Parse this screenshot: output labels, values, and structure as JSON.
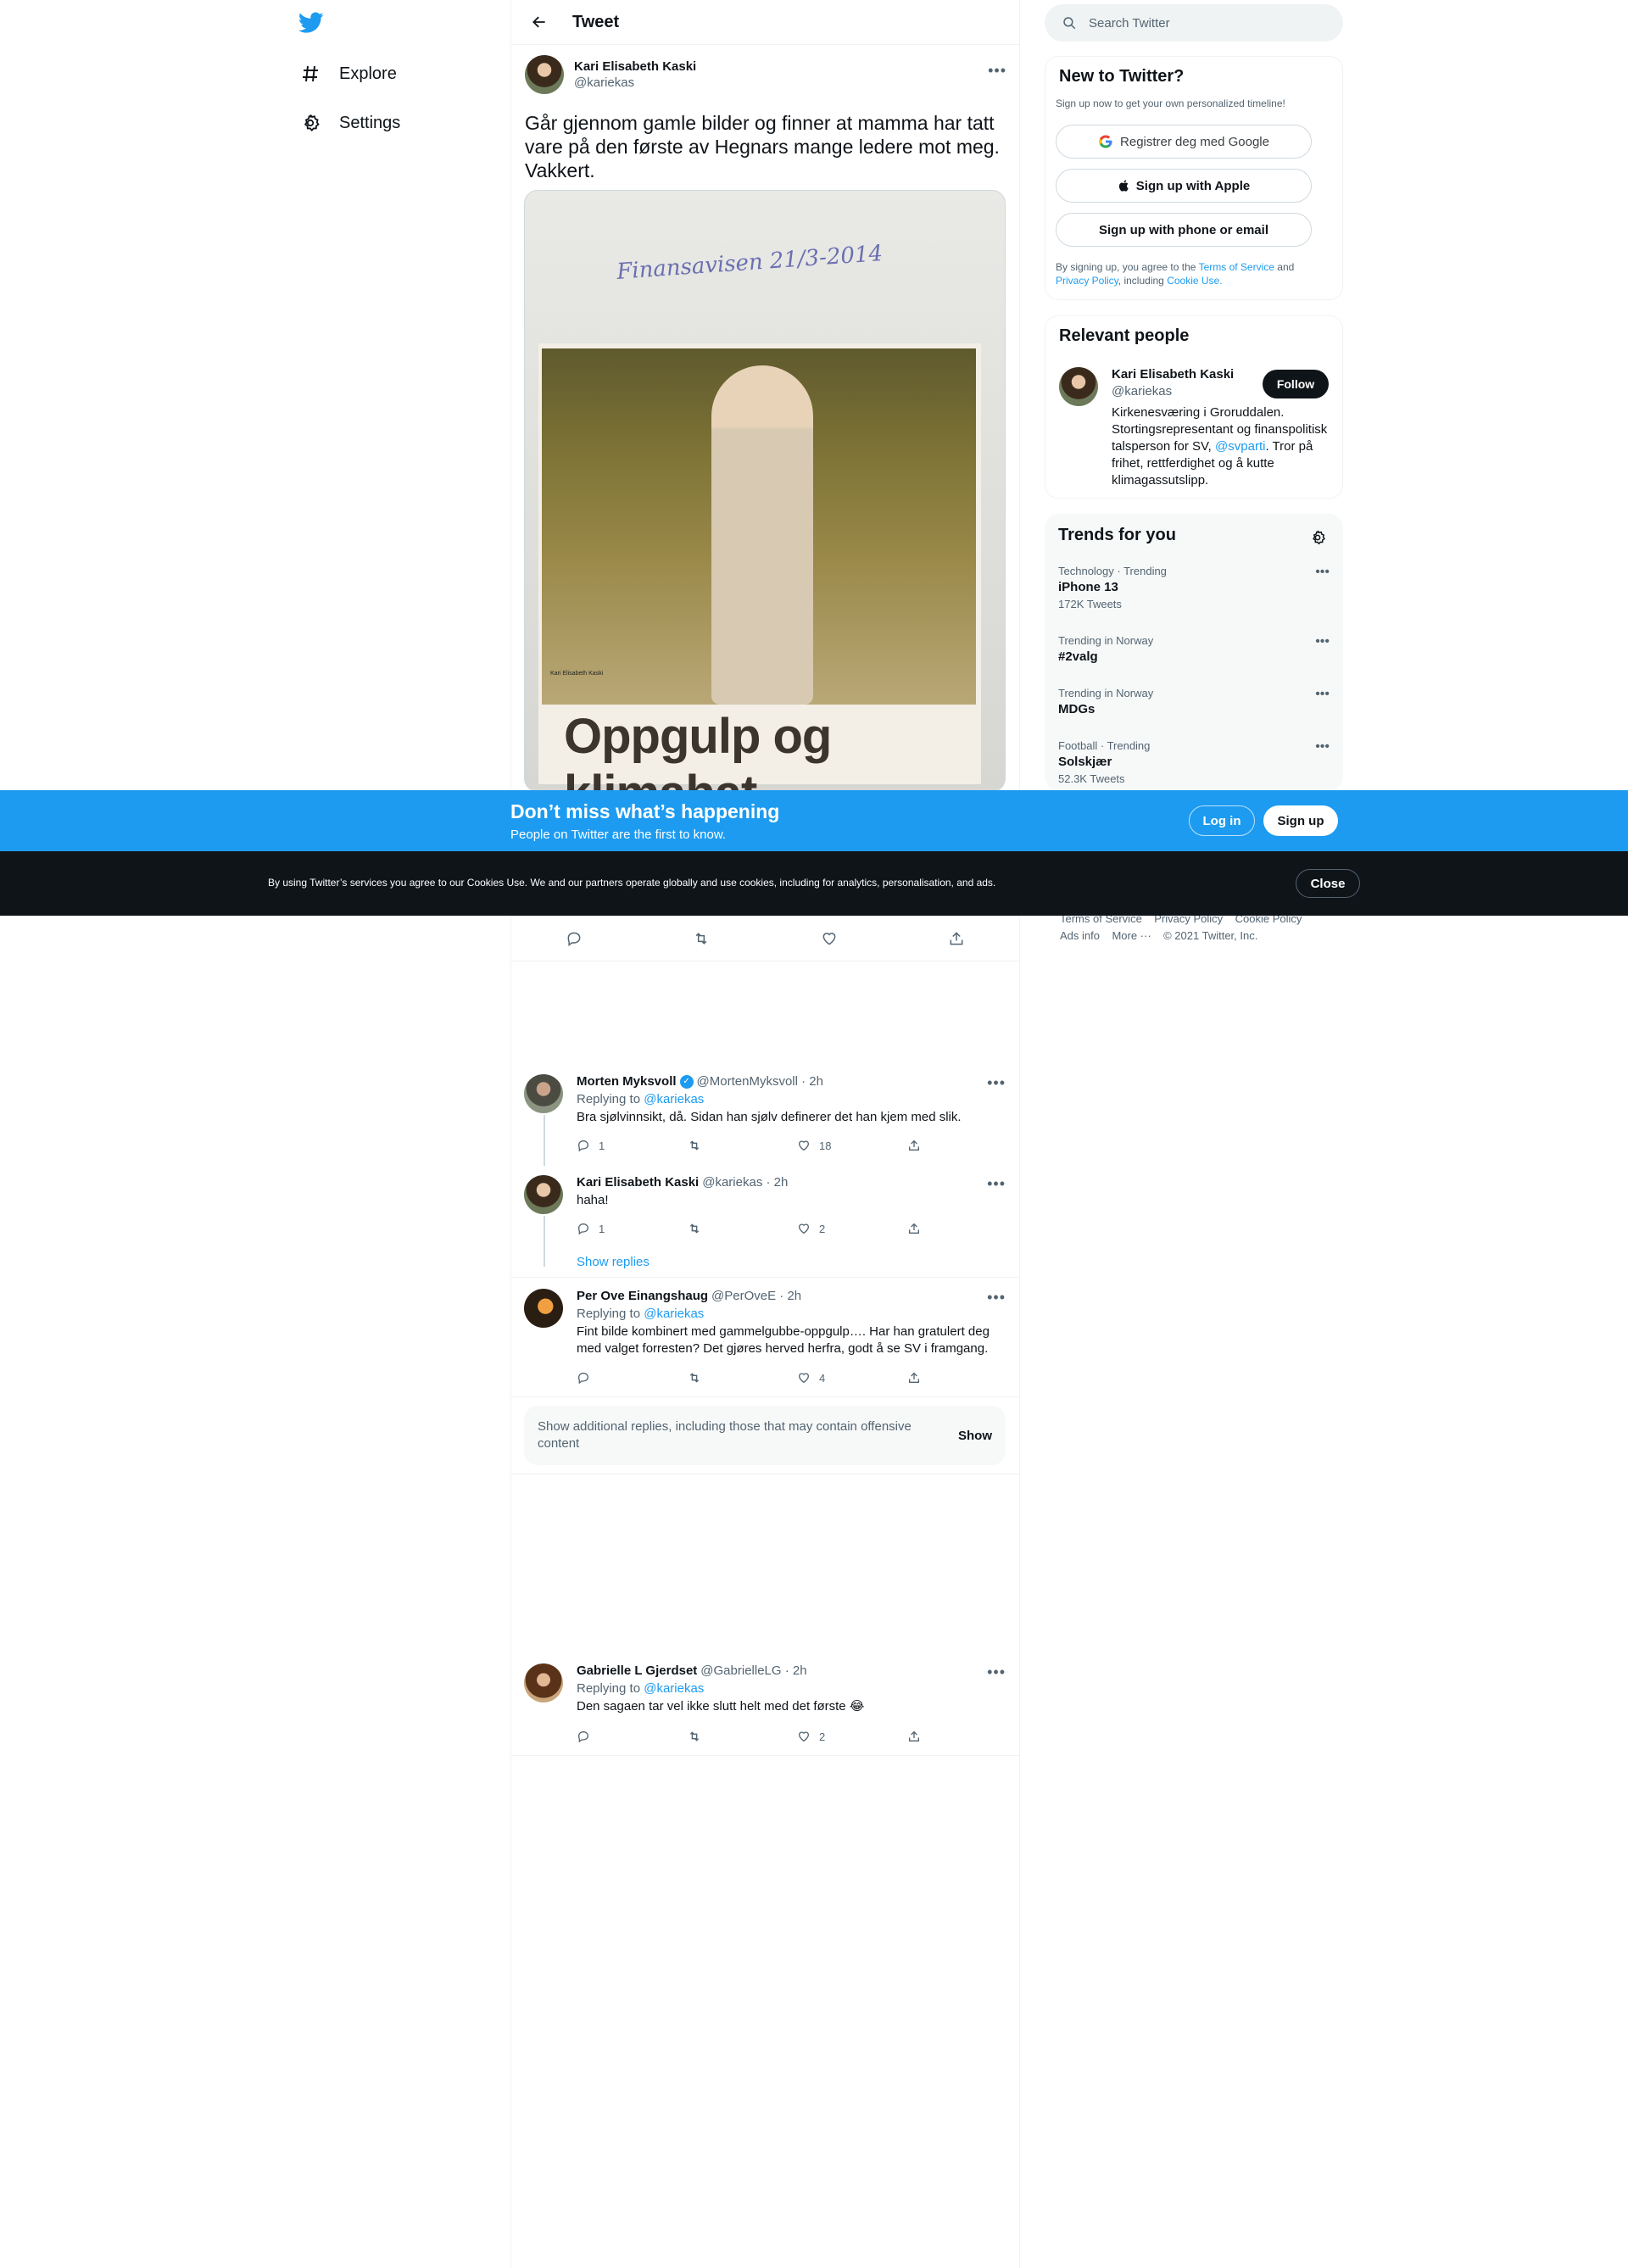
{
  "nav": {
    "items": [
      {
        "label": "Explore",
        "icon": "hashtag-icon"
      },
      {
        "label": "Settings",
        "icon": "gear-icon"
      }
    ]
  },
  "header": {
    "title": "Tweet"
  },
  "tweet": {
    "name": "Kari Elisabeth Kaski",
    "handle": "@kariekas",
    "text": "Går gjennom gamle bilder og finner at mamma har tatt vare på den første av Hegnars mange ledere mot meg. Vakkert.",
    "photo": {
      "handwriting": "Finansavisen 21/3-2014",
      "small_caption": "Kari Elisabeth Kaski",
      "headline": "Oppgulp og klimahat"
    }
  },
  "replies": [
    {
      "name": "Morten Myksvoll",
      "verified": true,
      "handle_time": "@MortenMyksvoll · 2h",
      "replying_prefix": "Replying to",
      "replying_to": "@kariekas",
      "text": "Bra sjølvinnsikt, då. Sidan han sjølv definerer det han kjem med slik.",
      "replies": "1",
      "retweets": "",
      "likes": "18"
    },
    {
      "name": "Kari Elisabeth Kaski",
      "handle_time": "@kariekas · 2h",
      "text": "haha!",
      "replies": "1",
      "retweets": "",
      "likes": "2",
      "show_replies": "Show replies"
    },
    {
      "name": "Per Ove Einangshaug",
      "handle_time": "@PerOveE · 2h",
      "replying_prefix": "Replying to",
      "replying_to": "@kariekas",
      "text": "Fint bilde kombinert med gammelgubbe-oppgulp…. Har han gratulert deg med valget forresten? Det gjøres herved herfra, godt å se SV i framgang.",
      "replies": "",
      "retweets": "",
      "likes": "4"
    },
    {
      "name": "Gabrielle L Gjerdset",
      "handle_time": "@GabrielleLG · 2h",
      "replying_prefix": "Replying to",
      "replying_to": "@kariekas",
      "text": "Den sagaen tar vel ikke slutt helt med det første 😂",
      "replies": "",
      "retweets": "",
      "likes": "2"
    }
  ],
  "show_more": {
    "text": "Show additional replies, including those that may contain offensive content",
    "button": "Show"
  },
  "search": {
    "placeholder": "Search Twitter"
  },
  "new_to_twitter": {
    "title": "New to Twitter?",
    "subtitle": "Sign up now to get your own personalized timeline!",
    "google": "Registrer deg med Google",
    "apple": "Sign up with Apple",
    "phone": "Sign up with phone or email",
    "terms_prefix": "By signing up, you agree to the",
    "terms": "Terms of Service",
    "and": "and",
    "privacy": "Privacy Policy",
    "including": ", including",
    "cookie": "Cookie Use."
  },
  "relevant": {
    "title": "Relevant people",
    "name": "Kari Elisabeth Kaski",
    "handle": "@kariekas",
    "follow": "Follow",
    "bio_1": "Kirkenesværing i Groruddalen. Stortingsrepresentant og finanspolitisk talsperson for SV,",
    "bio_link": "@svparti",
    "bio_2": ". Tror på frihet, rettferdighet og å kutte klimagassutslipp."
  },
  "trends": {
    "title": "Trends for you",
    "items": [
      {
        "meta": "Technology · Trending",
        "name": "iPhone 13",
        "count": "172K Tweets"
      },
      {
        "meta": "Trending in Norway",
        "name": "#2valg",
        "count": ""
      },
      {
        "meta": "Trending in Norway",
        "name": "MDGs",
        "count": ""
      },
      {
        "meta": "Football · Trending",
        "name": "Solskjær",
        "count": "52.3K Tweets"
      }
    ]
  },
  "footer": {
    "terms": "Terms of Service",
    "privacy": "Privacy Policy",
    "cookie": "Cookie Policy",
    "ads": "Ads info",
    "more": "More ···",
    "copyright": "© 2021 Twitter, Inc."
  },
  "banner": {
    "title": "Don’t miss what’s happening",
    "subtitle": "People on Twitter are the first to know.",
    "login": "Log in",
    "signup": "Sign up"
  },
  "cookie_bar": {
    "text": "By using Twitter’s services you agree to our Cookies Use. We and our partners operate globally and use cookies, including for analytics, personalisation, and ads.",
    "close": "Close"
  },
  "colors": {
    "accent": "#1d9bf0",
    "text": "#0f1419",
    "muted": "#536471",
    "cookie_bg": "#0f1419"
  }
}
